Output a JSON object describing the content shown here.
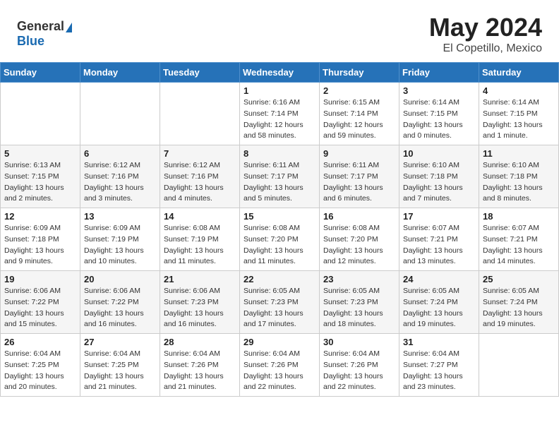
{
  "header": {
    "logo_general": "General",
    "logo_blue": "Blue",
    "title": "May 2024",
    "location": "El Copetillo, Mexico"
  },
  "weekdays": [
    "Sunday",
    "Monday",
    "Tuesday",
    "Wednesday",
    "Thursday",
    "Friday",
    "Saturday"
  ],
  "weeks": [
    [
      {
        "day": "",
        "info": ""
      },
      {
        "day": "",
        "info": ""
      },
      {
        "day": "",
        "info": ""
      },
      {
        "day": "1",
        "info": "Sunrise: 6:16 AM\nSunset: 7:14 PM\nDaylight: 12 hours and 58 minutes."
      },
      {
        "day": "2",
        "info": "Sunrise: 6:15 AM\nSunset: 7:14 PM\nDaylight: 12 hours and 59 minutes."
      },
      {
        "day": "3",
        "info": "Sunrise: 6:14 AM\nSunset: 7:15 PM\nDaylight: 13 hours and 0 minutes."
      },
      {
        "day": "4",
        "info": "Sunrise: 6:14 AM\nSunset: 7:15 PM\nDaylight: 13 hours and 1 minute."
      }
    ],
    [
      {
        "day": "5",
        "info": "Sunrise: 6:13 AM\nSunset: 7:15 PM\nDaylight: 13 hours and 2 minutes."
      },
      {
        "day": "6",
        "info": "Sunrise: 6:12 AM\nSunset: 7:16 PM\nDaylight: 13 hours and 3 minutes."
      },
      {
        "day": "7",
        "info": "Sunrise: 6:12 AM\nSunset: 7:16 PM\nDaylight: 13 hours and 4 minutes."
      },
      {
        "day": "8",
        "info": "Sunrise: 6:11 AM\nSunset: 7:17 PM\nDaylight: 13 hours and 5 minutes."
      },
      {
        "day": "9",
        "info": "Sunrise: 6:11 AM\nSunset: 7:17 PM\nDaylight: 13 hours and 6 minutes."
      },
      {
        "day": "10",
        "info": "Sunrise: 6:10 AM\nSunset: 7:18 PM\nDaylight: 13 hours and 7 minutes."
      },
      {
        "day": "11",
        "info": "Sunrise: 6:10 AM\nSunset: 7:18 PM\nDaylight: 13 hours and 8 minutes."
      }
    ],
    [
      {
        "day": "12",
        "info": "Sunrise: 6:09 AM\nSunset: 7:18 PM\nDaylight: 13 hours and 9 minutes."
      },
      {
        "day": "13",
        "info": "Sunrise: 6:09 AM\nSunset: 7:19 PM\nDaylight: 13 hours and 10 minutes."
      },
      {
        "day": "14",
        "info": "Sunrise: 6:08 AM\nSunset: 7:19 PM\nDaylight: 13 hours and 11 minutes."
      },
      {
        "day": "15",
        "info": "Sunrise: 6:08 AM\nSunset: 7:20 PM\nDaylight: 13 hours and 11 minutes."
      },
      {
        "day": "16",
        "info": "Sunrise: 6:08 AM\nSunset: 7:20 PM\nDaylight: 13 hours and 12 minutes."
      },
      {
        "day": "17",
        "info": "Sunrise: 6:07 AM\nSunset: 7:21 PM\nDaylight: 13 hours and 13 minutes."
      },
      {
        "day": "18",
        "info": "Sunrise: 6:07 AM\nSunset: 7:21 PM\nDaylight: 13 hours and 14 minutes."
      }
    ],
    [
      {
        "day": "19",
        "info": "Sunrise: 6:06 AM\nSunset: 7:22 PM\nDaylight: 13 hours and 15 minutes."
      },
      {
        "day": "20",
        "info": "Sunrise: 6:06 AM\nSunset: 7:22 PM\nDaylight: 13 hours and 16 minutes."
      },
      {
        "day": "21",
        "info": "Sunrise: 6:06 AM\nSunset: 7:23 PM\nDaylight: 13 hours and 16 minutes."
      },
      {
        "day": "22",
        "info": "Sunrise: 6:05 AM\nSunset: 7:23 PM\nDaylight: 13 hours and 17 minutes."
      },
      {
        "day": "23",
        "info": "Sunrise: 6:05 AM\nSunset: 7:23 PM\nDaylight: 13 hours and 18 minutes."
      },
      {
        "day": "24",
        "info": "Sunrise: 6:05 AM\nSunset: 7:24 PM\nDaylight: 13 hours and 19 minutes."
      },
      {
        "day": "25",
        "info": "Sunrise: 6:05 AM\nSunset: 7:24 PM\nDaylight: 13 hours and 19 minutes."
      }
    ],
    [
      {
        "day": "26",
        "info": "Sunrise: 6:04 AM\nSunset: 7:25 PM\nDaylight: 13 hours and 20 minutes."
      },
      {
        "day": "27",
        "info": "Sunrise: 6:04 AM\nSunset: 7:25 PM\nDaylight: 13 hours and 21 minutes."
      },
      {
        "day": "28",
        "info": "Sunrise: 6:04 AM\nSunset: 7:26 PM\nDaylight: 13 hours and 21 minutes."
      },
      {
        "day": "29",
        "info": "Sunrise: 6:04 AM\nSunset: 7:26 PM\nDaylight: 13 hours and 22 minutes."
      },
      {
        "day": "30",
        "info": "Sunrise: 6:04 AM\nSunset: 7:26 PM\nDaylight: 13 hours and 22 minutes."
      },
      {
        "day": "31",
        "info": "Sunrise: 6:04 AM\nSunset: 7:27 PM\nDaylight: 13 hours and 23 minutes."
      },
      {
        "day": "",
        "info": ""
      }
    ]
  ]
}
